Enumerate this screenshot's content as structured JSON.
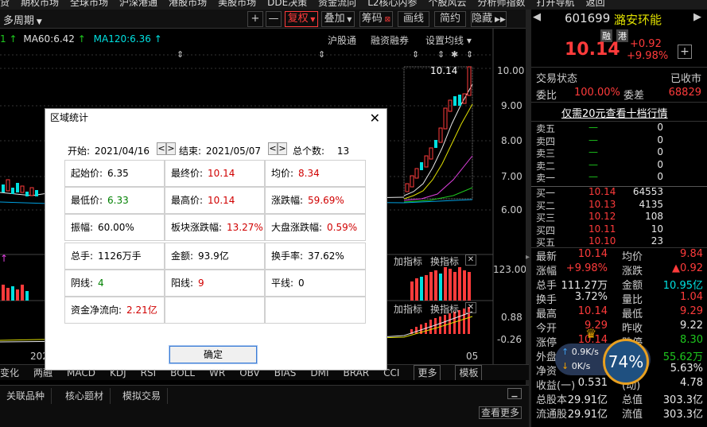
{
  "top_menu": [
    "贷",
    "期权市场",
    "全球市场",
    "沪深港通",
    "港股市场",
    "美股市场",
    "DDE决策",
    "资金流向",
    "L2核心内参",
    "个股风云",
    "分析师指数",
    "打开导航",
    "返回"
  ],
  "toolbar": {
    "period": "多周期",
    "plus": "+",
    "minus": "—",
    "fuquan": "复权",
    "overlay": "叠加",
    "chip": "筹码",
    "draw": "画线",
    "brief": "简约",
    "hide": "隐藏"
  },
  "indicators": {
    "ma60": "MA60:6.42",
    "ma120": "MA120:6.36",
    "hugu": "沪股通",
    "rongzi": "融资融券",
    "setma": "设置均线"
  },
  "price_axis": [
    "10.00",
    "9.00",
    "8.00",
    "7.00",
    "6.00"
  ],
  "vol_axis": [
    "123.00"
  ],
  "macd_axis": [
    "0.88",
    "-0.26"
  ],
  "high_label": "10.14",
  "date_left": "202",
  "date_right": "05",
  "sub_labels": {
    "add1": "加指标",
    "swap1": "换指标",
    "add2": "加指标",
    "swap2": "换指标"
  },
  "bottom_tabs": [
    "变化",
    "两融",
    "MACD",
    "KDJ",
    "RSI",
    "BOLL",
    "WR",
    "OBV",
    "BIAS",
    "DMI",
    "BRAR",
    "CCI",
    "更多",
    "模板"
  ],
  "footer_tabs": [
    "关联品种",
    "核心题材",
    "模拟交易"
  ],
  "footer_btn": "查看更多",
  "quote": {
    "code": "601699",
    "name": "潞安环能",
    "tag1": "融",
    "tag2": "港",
    "price": "10.14",
    "change": "+0.92",
    "pct": "+9.98%",
    "status_label": "交易状态",
    "status_value": "已收市",
    "wb_label": "委比",
    "wb_value": "100.00%",
    "wc_label": "委差",
    "wc_value": "68829",
    "tenlevel": "仅需20元查看十档行情"
  },
  "sells": [
    {
      "label": "卖五",
      "price": "—",
      "vol": "0"
    },
    {
      "label": "卖四",
      "price": "—",
      "vol": "0"
    },
    {
      "label": "卖三",
      "price": "—",
      "vol": "0"
    },
    {
      "label": "卖二",
      "price": "—",
      "vol": "0"
    },
    {
      "label": "卖一",
      "price": "—",
      "vol": "0"
    }
  ],
  "buys": [
    {
      "label": "买一",
      "price": "10.14",
      "vol": "64553"
    },
    {
      "label": "买二",
      "price": "10.13",
      "vol": "4135"
    },
    {
      "label": "买三",
      "price": "10.12",
      "vol": "108"
    },
    {
      "label": "买四",
      "price": "10.11",
      "vol": "10"
    },
    {
      "label": "买五",
      "price": "10.10",
      "vol": "23"
    }
  ],
  "stats": [
    {
      "l1": "最新",
      "v1": "10.14",
      "c1": "red",
      "l2": "均价",
      "v2": "9.84",
      "c2": "red"
    },
    {
      "l1": "涨幅",
      "v1": "+9.98%",
      "c1": "red",
      "l2": "涨跌",
      "v2": "▲0.92",
      "c2": "red"
    },
    {
      "l1": "总手",
      "v1": "111.27万",
      "c1": "white",
      "l2": "金额",
      "v2": "10.95亿",
      "c2": "cyan"
    },
    {
      "l1": "换手",
      "v1": "3.72%",
      "c1": "white",
      "l2": "量比",
      "v2": "1.04",
      "c2": "red"
    },
    {
      "l1": "最高",
      "v1": "10.14",
      "c1": "red",
      "l2": "最低",
      "v2": "9.29",
      "c2": "red"
    },
    {
      "l1": "今开",
      "v1": "9.29",
      "c1": "red",
      "l2": "昨收",
      "v2": "9.22",
      "c2": "white"
    },
    {
      "l1": "涨停",
      "v1": "10.14",
      "c1": "red",
      "l2": "跌停",
      "v2": "8.30",
      "c2": "green"
    },
    {
      "l1": "外盘",
      "v1": "",
      "c1": "white",
      "l2": "",
      "v2": "55.62万",
      "c2": "green"
    },
    {
      "l1": "净资",
      "v1": "",
      "c1": "white",
      "l2": "",
      "v2": "5.63%",
      "c2": "white"
    },
    {
      "l1": "收益(一)",
      "v1": "0.531",
      "c1": "white",
      "l2": "(动)",
      "v2": "4.78",
      "c2": "white"
    },
    {
      "l1": "总股本",
      "v1": "29.91亿",
      "c1": "white",
      "l2": "总值",
      "v2": "303.3亿",
      "c2": "white"
    },
    {
      "l1": "流通股",
      "v1": "29.91亿",
      "c1": "white",
      "l2": "流值",
      "v2": "303.3亿",
      "c2": "white"
    }
  ],
  "speed": {
    "up": "0.9K/s",
    "down": "0K/s",
    "pct": "74%"
  },
  "dialog": {
    "title": "区域统计",
    "close": "✕",
    "start_label": "开始:",
    "start_date": "2021/04/16",
    "end_label": "结束:",
    "end_date": "2021/05/07",
    "total_label": "总个数:",
    "total": "13",
    "cells": [
      {
        "label": "起始价:",
        "value": "6.35",
        "color": "black"
      },
      {
        "label": "最终价:",
        "value": "10.14",
        "color": "red"
      },
      {
        "label": "均价:",
        "value": "8.34",
        "color": "red"
      },
      {
        "label": "最低价:",
        "value": "6.33",
        "color": "green"
      },
      {
        "label": "最高价:",
        "value": "10.14",
        "color": "red"
      },
      {
        "label": "涨跌幅:",
        "value": "59.69%",
        "color": "red"
      },
      {
        "label": "振幅:",
        "value": "60.00%",
        "color": "black"
      },
      {
        "label": "板块涨跌幅:",
        "value": "13.27%",
        "color": "red"
      },
      {
        "label": "大盘涨跌幅:",
        "value": "0.59%",
        "color": "red"
      },
      {
        "label": "总手:",
        "value": "1126万手",
        "color": "black"
      },
      {
        "label": "金额:",
        "value": "93.9亿",
        "color": "black"
      },
      {
        "label": "换手率:",
        "value": "37.62%",
        "color": "black"
      },
      {
        "label": "阴线:",
        "value": "4",
        "color": "green"
      },
      {
        "label": "阳线:",
        "value": "9",
        "color": "red"
      },
      {
        "label": "平线:",
        "value": "0",
        "color": "black"
      },
      {
        "label": "资金净流向:",
        "value": "2.21亿",
        "color": "red"
      }
    ],
    "ok": "确定"
  }
}
